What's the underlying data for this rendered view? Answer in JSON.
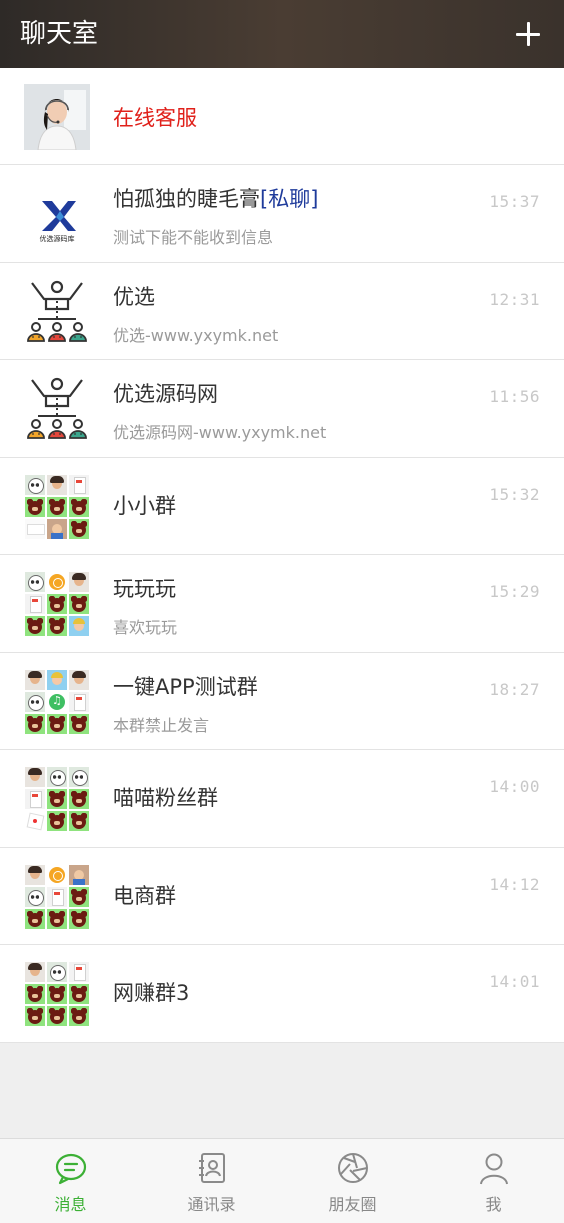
{
  "header": {
    "title": "聊天室",
    "add_icon": "plus-icon"
  },
  "service": {
    "name": "在线客服",
    "avatar_icon": "customer-service-avatar"
  },
  "chats": [
    {
      "name": "怕孤独的睫毛膏",
      "tag": "[私聊]",
      "preview": "测试下能不能收到信息",
      "time": "15:37",
      "avatar": "logo",
      "logo_text": "优选源码库"
    },
    {
      "name": "优选",
      "tag": "",
      "preview": "优选-www.yxymk.net",
      "time": "12:31",
      "avatar": "team-icon"
    },
    {
      "name": "优选源码网",
      "tag": "",
      "preview": "优选源码网-www.yxymk.net",
      "time": "11:56",
      "avatar": "team-icon"
    },
    {
      "name": "小小群",
      "tag": "",
      "preview": "",
      "time": "15:32",
      "avatar": "group-grid",
      "tiles": [
        "panda",
        "face",
        "card",
        "bear",
        "bear",
        "bear",
        "white",
        "boy",
        "bear"
      ]
    },
    {
      "name": "玩玩玩",
      "tag": "",
      "preview": "喜欢玩玩",
      "time": "15:29",
      "avatar": "group-grid",
      "tiles": [
        "panda",
        "orange",
        "face",
        "card",
        "bear",
        "bear",
        "bear",
        "bear",
        "girl"
      ]
    },
    {
      "name": "一键APP测试群",
      "tag": "",
      "preview": "本群禁止发言",
      "time": "18:27",
      "avatar": "group-grid",
      "tiles": [
        "face",
        "girl",
        "face",
        "panda",
        "green",
        "card",
        "bear",
        "bear",
        "bear"
      ]
    },
    {
      "name": "喵喵粉丝群",
      "tag": "",
      "preview": "",
      "time": "14:00",
      "avatar": "group-grid",
      "tiles": [
        "face",
        "panda",
        "panda",
        "card",
        "bear",
        "bear",
        "dice",
        "bear",
        "bear"
      ]
    },
    {
      "name": "电商群",
      "tag": "",
      "preview": "",
      "time": "14:12",
      "avatar": "group-grid",
      "tiles": [
        "face",
        "orange",
        "boy",
        "panda",
        "card",
        "bear",
        "bear",
        "bear",
        "bear"
      ]
    },
    {
      "name": "网赚群3",
      "tag": "",
      "preview": "",
      "time": "14:01",
      "avatar": "group-grid",
      "tiles": [
        "face",
        "panda",
        "card",
        "bear",
        "bear",
        "bear",
        "bear",
        "bear",
        "bear"
      ]
    }
  ],
  "tabbar": [
    {
      "label": "消息",
      "icon": "message-icon",
      "active": true
    },
    {
      "label": "通讯录",
      "icon": "contacts-icon",
      "active": false
    },
    {
      "label": "朋友圈",
      "icon": "moments-icon",
      "active": false
    },
    {
      "label": "我",
      "icon": "profile-icon",
      "active": false
    }
  ],
  "colors": {
    "active_tab": "#3cb035",
    "service_name": "#e0201a",
    "private_tag": "#1f3b9b",
    "header_bg": "#3a322c"
  }
}
